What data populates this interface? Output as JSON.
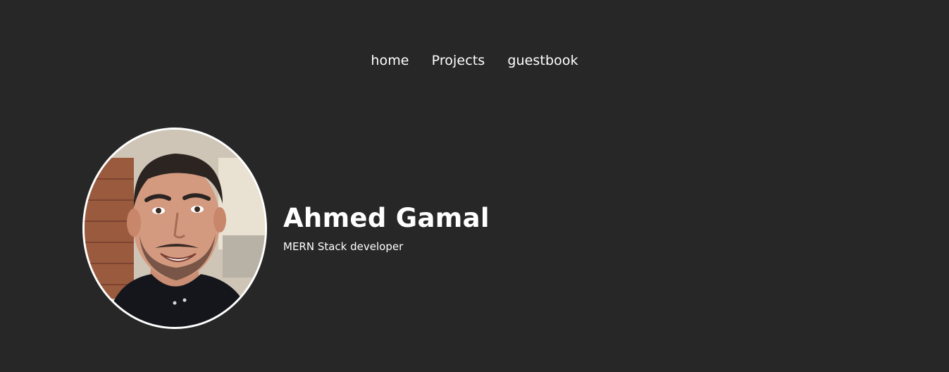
{
  "nav": {
    "items": [
      {
        "label": "home"
      },
      {
        "label": "Projects"
      },
      {
        "label": "guestbook"
      }
    ]
  },
  "profile": {
    "name": "Ahmed Gamal",
    "role": "MERN Stack developer",
    "avatar_icon": "profile-photo"
  },
  "colors": {
    "background": "#272727",
    "text": "#ffffff",
    "avatar_border": "#ffffff"
  }
}
